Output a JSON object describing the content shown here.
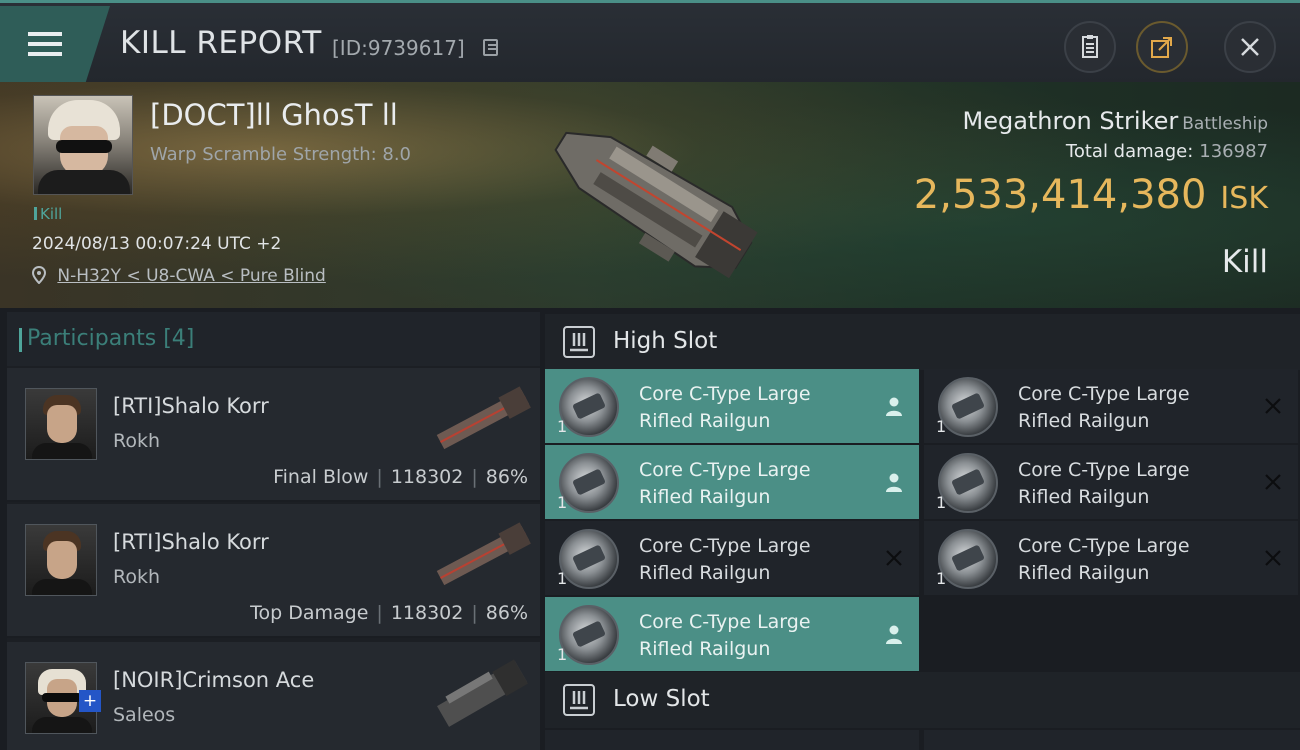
{
  "header": {
    "title": "KILL REPORT",
    "report_id": "[ID:9739617]",
    "icons": {
      "menu": "hamburger-menu-icon",
      "copy": "copy-icon",
      "clipboard": "clipboard-icon",
      "share": "share-icon",
      "close": "close-icon"
    }
  },
  "victim": {
    "name": "[DOCT]ll GhosT ll",
    "warp_scramble": "Warp Scramble Strength: 8.0",
    "kill_label": "Kill",
    "datetime": "2024/08/13 00:07:24 UTC +2",
    "location": "N-H32Y < U8-CWA < Pure Blind",
    "ship": "Megathron Striker",
    "ship_class": "Battleship",
    "total_damage_label": "Total damage:",
    "total_damage": "136987",
    "isk_value": "2,533,414,380",
    "isk_unit": "ISK",
    "result": "Kill"
  },
  "participants": {
    "header": "Participants [4]",
    "items": [
      {
        "name": "[RTI]Shalo Korr",
        "ship": "Rokh",
        "role": "Final Blow",
        "damage": "118302",
        "percent": "86%"
      },
      {
        "name": "[RTI]Shalo Korr",
        "ship": "Rokh",
        "role": "Top Damage",
        "damage": "118302",
        "percent": "86%"
      },
      {
        "name": "[NOIR]Crimson Ace",
        "ship": "Saleos",
        "role": "",
        "damage": "",
        "percent": ""
      }
    ]
  },
  "slots": {
    "high": {
      "label": "High Slot",
      "items": [
        {
          "name": "Core C-Type Large Rifled Railgun",
          "qty": "1",
          "state": "dropped"
        },
        {
          "name": "Core C-Type Large Rifled Railgun",
          "qty": "1",
          "state": "destroyed"
        },
        {
          "name": "Core C-Type Large Rifled Railgun",
          "qty": "1",
          "state": "dropped"
        },
        {
          "name": "Core C-Type Large Rifled Railgun",
          "qty": "1",
          "state": "destroyed"
        },
        {
          "name": "Core C-Type Large Rifled Railgun",
          "qty": "1",
          "state": "destroyed"
        },
        {
          "name": "Core C-Type Large Rifled Railgun",
          "qty": "1",
          "state": "destroyed"
        },
        {
          "name": "Core C-Type Large Rifled Railgun",
          "qty": "1",
          "state": "dropped"
        }
      ]
    },
    "low": {
      "label": "Low Slot"
    }
  },
  "colors": {
    "accent": "#4fa59b",
    "dropped": "#4b8f86",
    "isk": "#e6b75c"
  }
}
